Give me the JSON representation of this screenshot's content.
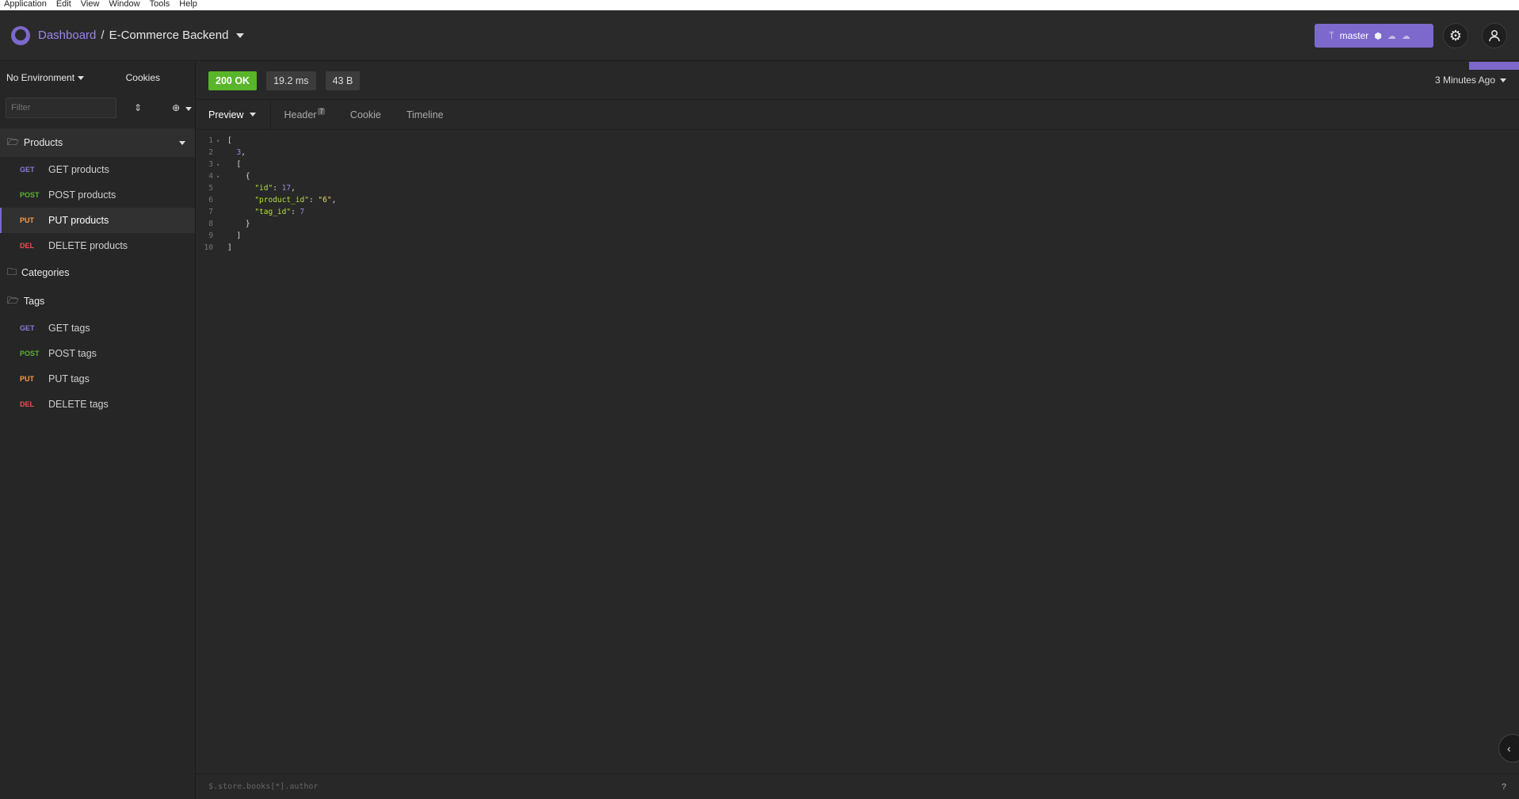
{
  "menubar": [
    "Application",
    "Edit",
    "View",
    "Window",
    "Tools",
    "Help"
  ],
  "header": {
    "dashboard": "Dashboard",
    "separator": "/",
    "project": "E-Commerce Backend",
    "branch": "master"
  },
  "sidebar": {
    "environment": "No Environment",
    "cookies": "Cookies",
    "filter_placeholder": "Filter",
    "folders": [
      {
        "name": "Products",
        "open": true,
        "items": [
          {
            "method": "GET",
            "label": "GET products"
          },
          {
            "method": "POST",
            "label": "POST products"
          },
          {
            "method": "PUT",
            "label": "PUT products",
            "active": true
          },
          {
            "method": "DEL",
            "label": "DELETE products"
          }
        ]
      },
      {
        "name": "Categories",
        "open": false,
        "items": []
      },
      {
        "name": "Tags",
        "open": true,
        "items": [
          {
            "method": "GET",
            "label": "GET tags"
          },
          {
            "method": "POST",
            "label": "POST tags"
          },
          {
            "method": "PUT",
            "label": "PUT tags"
          },
          {
            "method": "DEL",
            "label": "DELETE tags"
          }
        ]
      }
    ]
  },
  "response": {
    "status": "200 OK",
    "time": "19.2 ms",
    "size": "43 B",
    "ago": "3 Minutes Ago",
    "tabs": {
      "preview": "Preview",
      "header": "Header",
      "header_count": "7",
      "cookie": "Cookie",
      "timeline": "Timeline"
    },
    "code_lines": [
      "[",
      "  3,",
      "  [",
      "    {",
      "      \"id\": 17,",
      "      \"product_id\": \"6\",",
      "      \"tag_id\": 7",
      "    }",
      "  ]",
      "]"
    ],
    "filter_hint": "$.store.books[*].author",
    "help": "?"
  },
  "colors": {
    "accent": "#7d69cb",
    "ok": "#59b52a",
    "get": "#8a7adf",
    "post": "#59b52a",
    "put": "#ff9a3d",
    "delete": "#ef4f4f"
  }
}
